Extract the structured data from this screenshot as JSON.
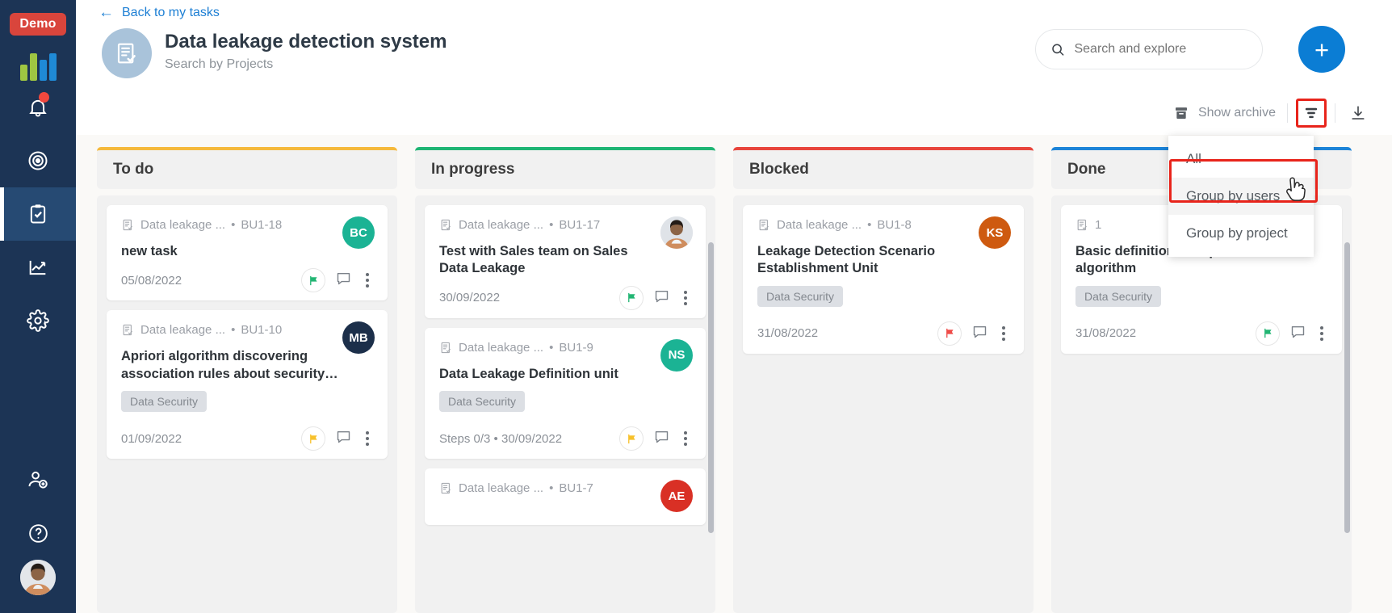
{
  "rail": {
    "demo_badge": "Demo",
    "items": [
      {
        "name": "logo",
        "label": "Bitrix logo"
      },
      {
        "name": "notifications",
        "label": "Notifications",
        "badge": true
      },
      {
        "name": "target",
        "label": "Focus"
      },
      {
        "name": "tasks",
        "label": "Tasks",
        "active": true
      },
      {
        "name": "reports",
        "label": "Reports"
      },
      {
        "name": "settings",
        "label": "Settings"
      },
      {
        "name": "invite",
        "label": "Invite user"
      },
      {
        "name": "help",
        "label": "Help"
      }
    ]
  },
  "header": {
    "back_link": "Back to my tasks",
    "title": "Data leakage detection system",
    "subtitle": "Search by Projects",
    "add_label": "+"
  },
  "search": {
    "placeholder": "Search and explore",
    "value": ""
  },
  "toolbar": {
    "show_archive": "Show archive"
  },
  "dropdown": {
    "items": [
      {
        "label": "All",
        "highlighted": false
      },
      {
        "label": "Group by users",
        "highlighted": true
      },
      {
        "label": "Group by project",
        "highlighted": false
      }
    ]
  },
  "colors": {
    "todo": "#f5b93c",
    "in_progress": "#1fb574",
    "blocked": "#e8453c",
    "done": "#1d84d8",
    "accent": "#0b7dd4",
    "rail": "#1c3455",
    "highlight": "#e8241b"
  },
  "board": {
    "columns": [
      {
        "title": "To do",
        "accent": "#f5b93c",
        "cards": [
          {
            "project": "Data leakage ...",
            "code": "BU1-18",
            "title": "new task",
            "tag": null,
            "date": "05/08/2022",
            "steps": null,
            "flag_color": "#22b573",
            "avatar": {
              "initials": "BC",
              "color": "#1bb394",
              "photo": false
            }
          },
          {
            "project": "Data leakage ...",
            "code": "BU1-10",
            "title": "Apriori algorithm discovering association rules about security…",
            "tag": "Data Security",
            "date": "01/09/2022",
            "steps": null,
            "flag_color": "#f7c12b",
            "avatar": {
              "initials": "MB",
              "color": "#1c2f4a",
              "photo": false
            }
          }
        ]
      },
      {
        "title": "In progress",
        "accent": "#1fb574",
        "cards": [
          {
            "project": "Data leakage ...",
            "code": "BU1-17",
            "title": "Test with Sales team on Sales Data Leakage",
            "tag": null,
            "date": "30/09/2022",
            "steps": null,
            "flag_color": "#22b573",
            "avatar": {
              "initials": "",
              "color": "#d8dde3",
              "photo": true
            }
          },
          {
            "project": "Data leakage ...",
            "code": "BU1-9",
            "title": "Data Leakage Definition unit",
            "tag": "Data Security",
            "date": "30/09/2022",
            "steps": "Steps 0/3",
            "flag_color": "#f7c12b",
            "avatar": {
              "initials": "NS",
              "color": "#1bb394",
              "photo": false
            }
          },
          {
            "project": "Data leakage ...",
            "code": "BU1-7",
            "title": "",
            "tag": null,
            "date": "",
            "steps": null,
            "flag_color": null,
            "avatar": {
              "initials": "AE",
              "color": "#d93025",
              "photo": false
            }
          }
        ]
      },
      {
        "title": "Blocked",
        "accent": "#e8453c",
        "cards": [
          {
            "project": "Data leakage ...",
            "code": "BU1-8",
            "title": "Leakage Detection Scenario Establishment Unit",
            "tag": "Data Security",
            "date": "31/08/2022",
            "steps": null,
            "flag_color": "#ef4b48",
            "avatar": {
              "initials": "KS",
              "color": "#ce5a10",
              "photo": false
            }
          }
        ]
      },
      {
        "title": "Done",
        "accent": "#1d84d8",
        "cards": [
          {
            "project": "",
            "code": "1",
            "title": "Basic definition for Apriori algorithm",
            "tag": "Data Security",
            "date": "31/08/2022",
            "steps": null,
            "flag_color": "#22b573",
            "avatar": null
          }
        ]
      }
    ]
  }
}
